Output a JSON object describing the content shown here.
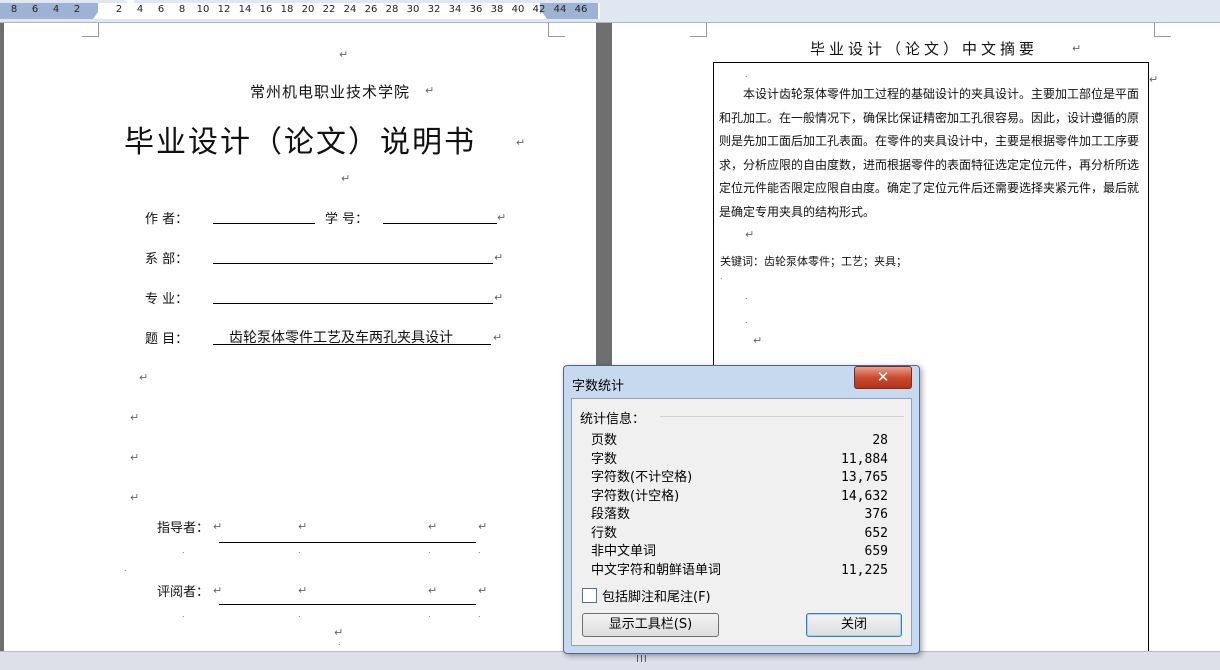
{
  "ruler": {
    "numbers": [
      "8",
      "6",
      "4",
      "2",
      "2",
      "4",
      "6",
      "8",
      "10",
      "12",
      "14",
      "16",
      "18",
      "20",
      "22",
      "24",
      "26",
      "28",
      "30",
      "32",
      "34",
      "36",
      "38",
      "40",
      "42",
      "44",
      "46"
    ]
  },
  "cover": {
    "school": "常州机电职业技术学院",
    "title": "毕业设计（论文）说明书",
    "author_label": "作    者：",
    "student_no_label": "学    号：",
    "dept_label": "系    部：",
    "major_label": "专    业：",
    "topic_label": "题    目：",
    "topic_value": "齿轮泵体零件工艺及车两孔夹具设计",
    "advisor_label": "指导者：",
    "reviewer_label": "评阅者："
  },
  "abstract": {
    "heading": "毕业设计（论文）中文摘要",
    "lines": [
      "本设计齿轮泵体零件加工过程的基础设计的夹具设计。主要加工部位是平面",
      "和孔加工。在一般情况下，确保比保证精密加工孔很容易。因此，设计遵循的原",
      "则是先加工面后加工孔表面。在零件的夹具设计中，主要是根据零件加工工序要",
      "求，分析应限的自由度数，进而根据零件的表面特征选定定位元件，再分析所选",
      "定位元件能否限定应限自由度。确定了定位元件后还需要选择夹紧元件，最后就",
      "是确定专用夹具的结构形式。"
    ],
    "keywords": "关键词：齿轮泵体零件；工艺；夹具；"
  },
  "dialog": {
    "title": "字数统计",
    "close_icon": "close-x-icon",
    "section_label": "统计信息：",
    "stats": [
      {
        "label": "页数",
        "value": "28"
      },
      {
        "label": "字数",
        "value": "11,884"
      },
      {
        "label": "字符数(不计空格)",
        "value": "13,765"
      },
      {
        "label": "字符数(计空格)",
        "value": "14,632"
      },
      {
        "label": "段落数",
        "value": "376"
      },
      {
        "label": "行数",
        "value": "652"
      },
      {
        "label": "非中文单词",
        "value": "659"
      },
      {
        "label": "中文字符和朝鲜语单词",
        "value": "11,225"
      }
    ],
    "checkbox_label": "包括脚注和尾注(F)",
    "checkbox_checked": false,
    "toolbar_button": "显示工具栏(S)",
    "close_button": "关闭"
  },
  "status": {
    "splitter_glyph": "III"
  },
  "colors": {
    "ruler_bg": "#dfe7f3",
    "dialog_bg": "#c6d9ef",
    "close_red": "#c84c30",
    "gutter": "#6f6f6f"
  }
}
